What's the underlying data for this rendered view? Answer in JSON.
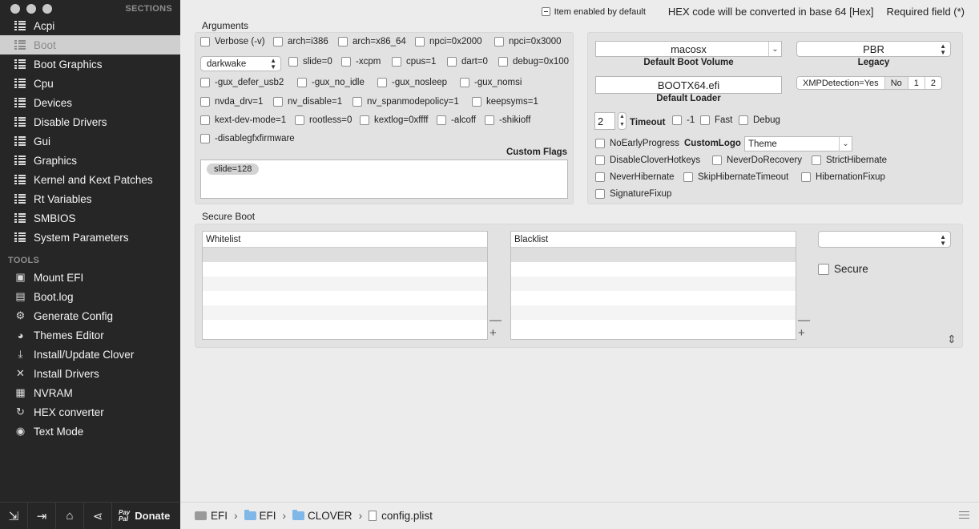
{
  "sidebar": {
    "sections_header": "SECTIONS",
    "tools_header": "TOOLS",
    "sections": [
      {
        "label": "Acpi",
        "icon": "grid-list-icon"
      },
      {
        "label": "Boot",
        "icon": "grid-list-icon",
        "selected": true
      },
      {
        "label": "Boot Graphics",
        "icon": "grid-list-icon"
      },
      {
        "label": "Cpu",
        "icon": "grid-list-icon"
      },
      {
        "label": "Devices",
        "icon": "grid-list-icon"
      },
      {
        "label": "Disable Drivers",
        "icon": "grid-list-icon"
      },
      {
        "label": "Gui",
        "icon": "grid-list-icon"
      },
      {
        "label": "Graphics",
        "icon": "grid-list-icon"
      },
      {
        "label": "Kernel and Kext Patches",
        "icon": "grid-list-icon"
      },
      {
        "label": "Rt Variables",
        "icon": "grid-list-icon"
      },
      {
        "label": "SMBIOS",
        "icon": "grid-list-icon"
      },
      {
        "label": "System Parameters",
        "icon": "grid-list-icon"
      }
    ],
    "tools": [
      {
        "label": "Mount EFI",
        "icon": "disk-icon"
      },
      {
        "label": "Boot.log",
        "icon": "log-icon"
      },
      {
        "label": "Generate Config",
        "icon": "gear-icon"
      },
      {
        "label": "Themes Editor",
        "icon": "palette-icon"
      },
      {
        "label": "Install/Update Clover",
        "icon": "download-icon"
      },
      {
        "label": "Install Drivers",
        "icon": "tools-icon"
      },
      {
        "label": "NVRAM",
        "icon": "chip-icon"
      },
      {
        "label": "HEX converter",
        "icon": "refresh-icon"
      },
      {
        "label": "Text Mode",
        "icon": "eye-icon"
      }
    ],
    "donate_label": "Donate",
    "paypal_line1": "Pay",
    "paypal_line2": "Pal"
  },
  "header": {
    "item_enabled_label": "Item enabled by default",
    "hex_note": "HEX code will be converted in base 64 [Hex]",
    "required_note": "Required field (*)"
  },
  "arguments": {
    "title": "Arguments",
    "flags": [
      "Verbose (-v)",
      "arch=i386",
      "arch=x86_64",
      "npci=0x2000",
      "npci=0x3000",
      "slide=0",
      "-xcpm",
      "cpus=1",
      "dart=0",
      "debug=0x100",
      "-gux_defer_usb2",
      "-gux_no_idle",
      "-gux_nosleep",
      "-gux_nomsi",
      "nvda_drv=1",
      "nv_disable=1",
      "nv_spanmodepolicy=1",
      "keepsyms=1",
      "kext-dev-mode=1",
      "rootless=0",
      "kextlog=0xffff",
      "-alcoff",
      "-shikioff",
      "-disablegfxfirmware"
    ],
    "darkwake_value": "darkwake",
    "custom_flags_label": "Custom Flags",
    "custom_flag_token": "slide=128"
  },
  "boot_options": {
    "default_volume_value": "macosx",
    "default_volume_caption": "Default Boot Volume",
    "legacy_value": "PBR",
    "legacy_caption": "Legacy",
    "default_loader_value": "BOOTX64.efi",
    "default_loader_caption": "Default Loader",
    "xmp_segments": [
      "XMPDetection=Yes",
      "No",
      "1",
      "2"
    ],
    "timeout_value": "2",
    "timeout_label": "Timeout",
    "minus_one_label": "-1",
    "fast_label": "Fast",
    "debug_label": "Debug",
    "no_early_progress": "NoEarlyProgress",
    "custom_logo_label": "CustomLogo",
    "custom_logo_value": "Theme",
    "disable_clover_hotkeys": "DisableCloverHotkeys",
    "never_do_recovery": "NeverDoRecovery",
    "strict_hibernate": "StrictHibernate",
    "never_hibernate": "NeverHibernate",
    "skip_hibernate_timeout": "SkipHibernateTimeout",
    "hibernation_fixup": "HibernationFixup",
    "signature_fixup": "SignatureFixup"
  },
  "secure_boot": {
    "title": "Secure Boot",
    "whitelist_header": "Whitelist",
    "blacklist_header": "Blacklist",
    "policy_value": "",
    "secure_label": "Secure"
  },
  "pathbar": {
    "crumbs": [
      "EFI",
      "EFI",
      "CLOVER",
      "config.plist"
    ]
  }
}
